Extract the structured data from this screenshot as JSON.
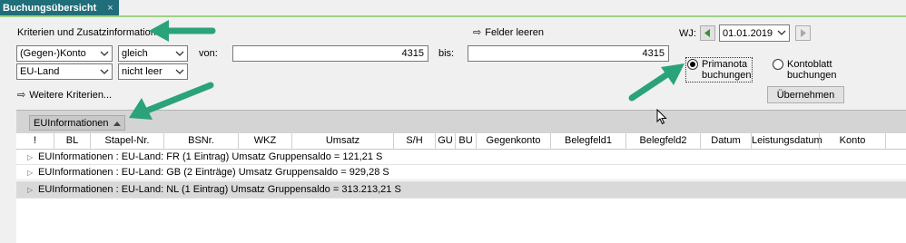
{
  "tab": {
    "title": "Buchungsübersicht",
    "close": "×"
  },
  "criteria": {
    "heading": "Kriterien und Zusatzinformationen",
    "clear_fields": "Felder leeren",
    "more_criteria": "Weitere Kriterien...",
    "row1": {
      "field": "(Gegen-)Konto",
      "operator": "gleich",
      "from_label": "von:",
      "from_value": "4315",
      "to_label": "bis:",
      "to_value": "4315"
    },
    "row2": {
      "field": "EU-Land",
      "operator": "nicht leer"
    }
  },
  "fiscal_year": {
    "label": "WJ:",
    "value": "01.01.2019"
  },
  "radio": {
    "option1": "Primanota\nbuchungen",
    "option1_line1": "Primanota",
    "option1_line2": "buchungen",
    "option2_line1": "Kontoblatt",
    "option2_line2": "buchungen",
    "selected": "Primanota"
  },
  "apply_button": "Übernehmen",
  "grid": {
    "group_chip": "EUInformationen",
    "columns": [
      "!",
      "BL",
      "Stapel-Nr.",
      "BSNr.",
      "WKZ",
      "Umsatz",
      "S/H",
      "GU",
      "BU",
      "Gegenkonto",
      "Belegfeld1",
      "Belegfeld2",
      "Datum",
      "Leistungsdatum",
      "Konto"
    ],
    "rows": [
      "EUInformationen : EU-Land: FR (1 Eintrag) Umsatz Gruppensaldo = 121,21 S",
      "EUInformationen : EU-Land: GB (2 Einträge) Umsatz Gruppensaldo = 929,28 S",
      "EUInformationen : EU-Land: NL (1 Eintrag) Umsatz Gruppensaldo = 313.213,21 S"
    ]
  },
  "colors": {
    "tab_bg": "#1f6e7a",
    "accent_line": "#9fd08a",
    "annotation_arrow": "#2aa37a",
    "nav_arrow": "#3c8d3c"
  }
}
